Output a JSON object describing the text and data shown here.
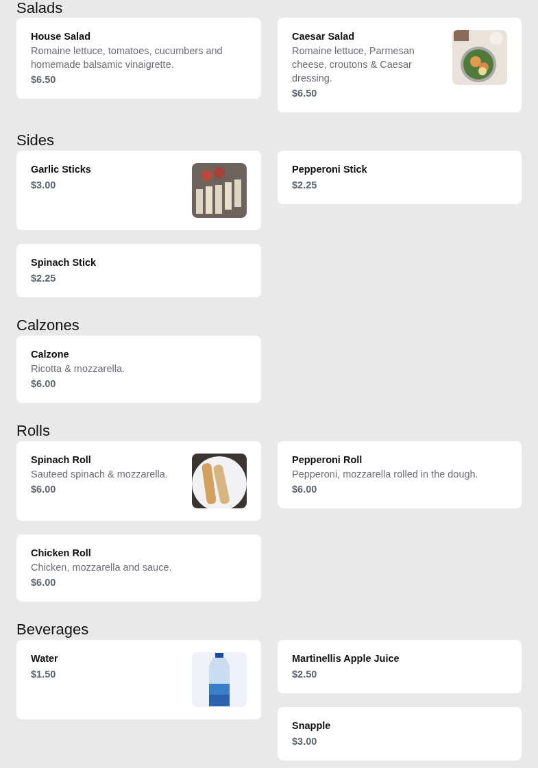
{
  "sections": [
    {
      "heading": "Salads",
      "columns": [
        {
          "items": [
            {
              "name": "House Salad",
              "description": "Romaine lettuce, tomatoes, cucumbers and homemade balsamic vinaigrette.",
              "price": "$6.50"
            }
          ]
        },
        {
          "items": [
            {
              "name": "Caesar Salad",
              "description": "Romaine lettuce, Parmesan cheese, croutons & Caesar dressing.",
              "price": "$6.50"
            }
          ]
        }
      ]
    },
    {
      "heading": "Sides",
      "columns": [
        {
          "items": [
            {
              "name": "Garlic Sticks",
              "price": "$3.00"
            },
            {
              "name": "Spinach Stick",
              "price": "$2.25"
            }
          ]
        },
        {
          "items": [
            {
              "name": "Pepperoni Stick",
              "price": "$2.25"
            }
          ]
        }
      ]
    },
    {
      "heading": "Calzones",
      "columns": [
        {
          "items": [
            {
              "name": "Calzone",
              "description": "Ricotta & mozzarella.",
              "price": "$6.00"
            }
          ]
        }
      ]
    },
    {
      "heading": "Rolls",
      "columns": [
        {
          "items": [
            {
              "name": "Spinach Roll",
              "description": "Sauteed spinach & mozzarella.",
              "price": "$6.00"
            },
            {
              "name": "Chicken Roll",
              "description": "Chicken, mozzarella and sauce.",
              "price": "$6.00"
            }
          ]
        },
        {
          "items": [
            {
              "name": "Pepperoni Roll",
              "description": "Pepperoni, mozzarella rolled in the dough.",
              "price": "$6.00"
            }
          ]
        }
      ]
    },
    {
      "heading": "Beverages",
      "columns": [
        {
          "items": [
            {
              "name": "Water",
              "price": "$1.50"
            }
          ]
        },
        {
          "items": [
            {
              "name": "Martinellis Apple Juice",
              "price": "$2.50"
            },
            {
              "name": "Snapple",
              "price": "$3.00"
            }
          ]
        }
      ]
    }
  ]
}
